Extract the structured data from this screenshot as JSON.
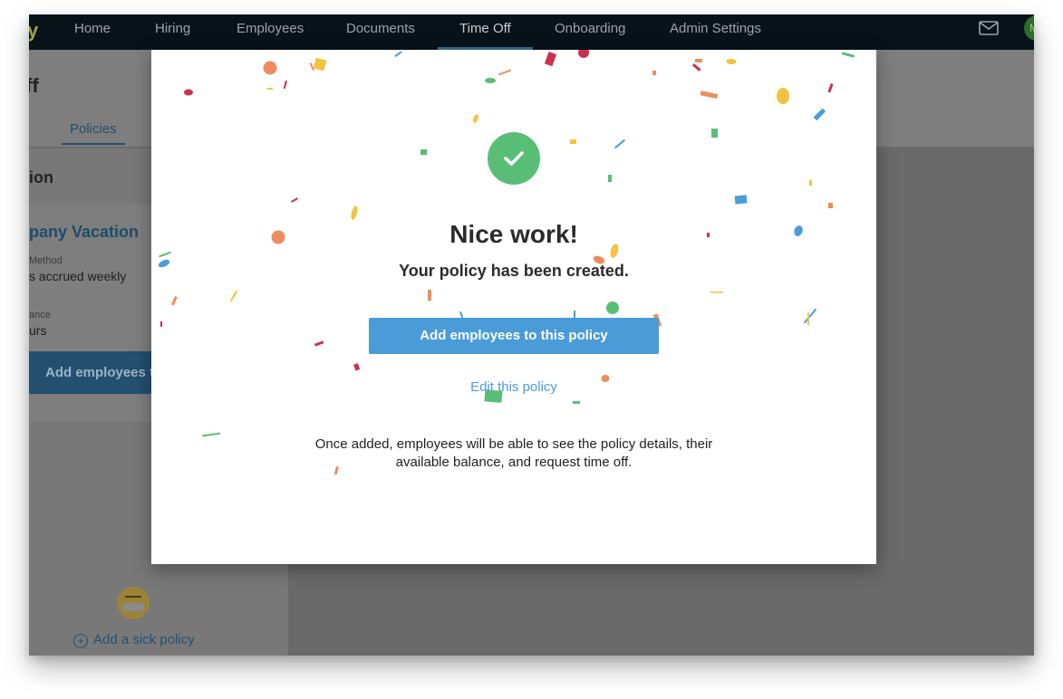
{
  "topnav": {
    "brand": "y",
    "items": [
      {
        "label": "Home"
      },
      {
        "label": "Hiring"
      },
      {
        "label": "Employees"
      },
      {
        "label": "Documents"
      },
      {
        "label": "Time Off",
        "active": true
      },
      {
        "label": "Onboarding"
      },
      {
        "label": "Admin Settings"
      }
    ],
    "avatar_initial": "M",
    "icons": [
      "mail-icon"
    ]
  },
  "background_page": {
    "title": "ff",
    "tab": "Policies",
    "section_title": "ion",
    "policy_card": {
      "name": "pany Vacation",
      "field1_label": "Method",
      "field1_value": "s accrued weekly",
      "field2_label": "ance",
      "field2_value": "urs",
      "button": "Add employees to"
    },
    "add_sick_policy": "Add a sick policy"
  },
  "modal": {
    "title": "Nice work!",
    "subtitle": "Your policy has been created.",
    "primary_button": "Add employees to this policy",
    "edit_link": "Edit this policy",
    "note": "Once added, employees will be able to see the policy details, their available balance, and request time off.",
    "icons": [
      "check-circle-icon"
    ]
  },
  "colors": {
    "accent": "#4a9bd8",
    "success": "#58be76",
    "nav_bg": "#081219"
  }
}
